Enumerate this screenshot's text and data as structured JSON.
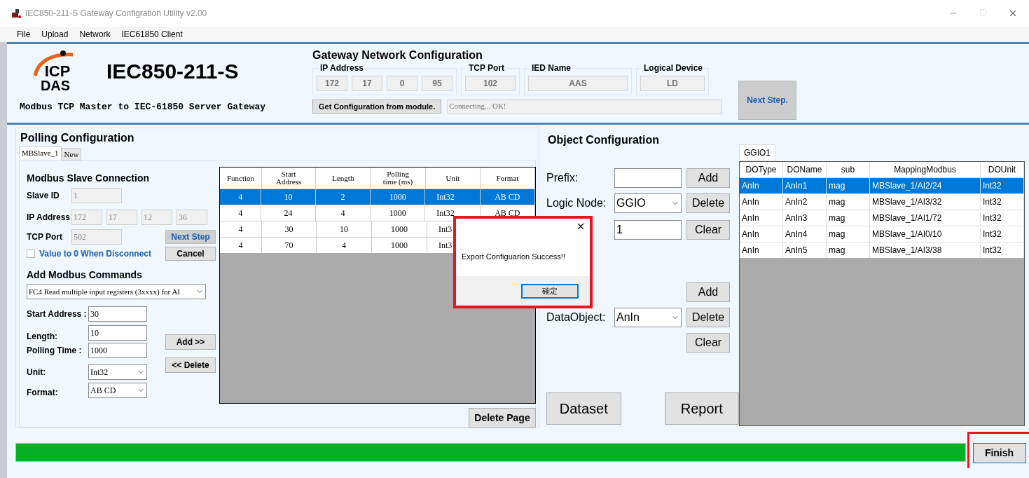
{
  "window": {
    "title": "IEC850-211-S Gateway Configration Utility v2.00"
  },
  "menu": [
    "File",
    "Upload",
    "Network",
    "IEC61850 Client"
  ],
  "header": {
    "logo_top": "ICP",
    "logo_bottom": "DAS",
    "product": "IEC850-211-S",
    "subtitle": "Modbus TCP Master to IEC-61850 Server Gateway"
  },
  "gateway": {
    "title": "Gateway Network Configuration",
    "ip_label": "IP Address",
    "ip": [
      "172",
      "17",
      "0",
      "95"
    ],
    "port_label": "TCP Port",
    "port": "102",
    "ied_label": "IED Name",
    "ied": "AAS",
    "ld_label": "Logical Device",
    "ld": "LD",
    "get_button": "Get Configuration from module.",
    "status": "Connecting... OK!",
    "next_button": "Next Step."
  },
  "polling": {
    "title": "Polling Configuration",
    "tabs": [
      {
        "label": "MBSlave_1",
        "selected": true
      },
      {
        "label": "New",
        "selected": false
      }
    ],
    "slave": {
      "heading": "Modbus Slave Connection",
      "slave_id_label": "Slave ID",
      "slave_id": "1",
      "ip_label": "IP Address",
      "ip": [
        "172",
        "17",
        "12",
        "36"
      ],
      "port_label": "TCP Port",
      "port": "502",
      "next_button": "Next Step",
      "cancel_button": "Cancel",
      "disconnect": {
        "label": "Value to 0 When Disconnect",
        "checked": false
      }
    },
    "commands": {
      "heading": "Add Modbus Commands",
      "function": "FC4 Read multiple input registers (3xxxx) for AI",
      "start_label": "Start Address :",
      "start": "30",
      "length_label": "Length:",
      "length": "10",
      "polling_label": "Polling Time :",
      "polling": "1000",
      "unit_label": "Unit:",
      "unit": "Int32",
      "format_label": "Format:",
      "format": "AB CD",
      "add_button": "Add >>",
      "delete_button": "<< Delete"
    },
    "table": {
      "columns": [
        "Function",
        "Start Address",
        "Length",
        "Polling time (ms)",
        "Unit",
        "Format"
      ],
      "rows": [
        {
          "cells": [
            "4",
            "10",
            "2",
            "1000",
            "Int32",
            "AB CD"
          ],
          "selected": true
        },
        {
          "cells": [
            "4",
            "24",
            "4",
            "1000",
            "Int32",
            "AB CD"
          ],
          "selected": false
        },
        {
          "cells": [
            "4",
            "30",
            "10",
            "1000",
            "Int3"
          ],
          "selected": false
        },
        {
          "cells": [
            "4",
            "70",
            "4",
            "1000",
            "Int3"
          ],
          "selected": false
        }
      ]
    },
    "delete_page": "Delete Page"
  },
  "object": {
    "title": "Object Configuration",
    "prefix_label": "Prefix:",
    "logic_node_label": "Logic Node:",
    "logic_node": "GGIO",
    "instance": "1",
    "ln_buttons": [
      "Add",
      "Delete",
      "Clear"
    ],
    "data_object_label": "DataObject:",
    "data_object": "AnIn",
    "do_buttons": [
      "Add",
      "Delete",
      "Clear"
    ],
    "dataset": "Dataset",
    "report": "Report"
  },
  "ggio": {
    "tabs": [
      {
        "label": "GGIO1",
        "selected": true
      }
    ],
    "columns": [
      "DOType",
      "DOName",
      "sub",
      "MappingModbus",
      "DOUnit"
    ],
    "rows": [
      {
        "cells": [
          "AnIn",
          "AnIn1",
          "mag",
          "MBSlave_1/AI2/24",
          "Int32"
        ],
        "selected": true
      },
      {
        "cells": [
          "AnIn",
          "AnIn2",
          "mag",
          "MBSlave_1/AI3/32",
          "Int32"
        ],
        "selected": false
      },
      {
        "cells": [
          "AnIn",
          "AnIn3",
          "mag",
          "MBSlave_1/AI1/72",
          "Int32"
        ],
        "selected": false
      },
      {
        "cells": [
          "AnIn",
          "AnIn4",
          "mag",
          "MBSlave_1/AI0/10",
          "Int32"
        ],
        "selected": false
      },
      {
        "cells": [
          "AnIn",
          "AnIn5",
          "mag",
          "MBSlave_1/AI3/38",
          "Int32"
        ],
        "selected": false
      }
    ]
  },
  "dialog": {
    "message": "Export Configuarion Success!!",
    "ok": "確定"
  },
  "progress": {
    "level": 1
  },
  "finish": "Finish"
}
